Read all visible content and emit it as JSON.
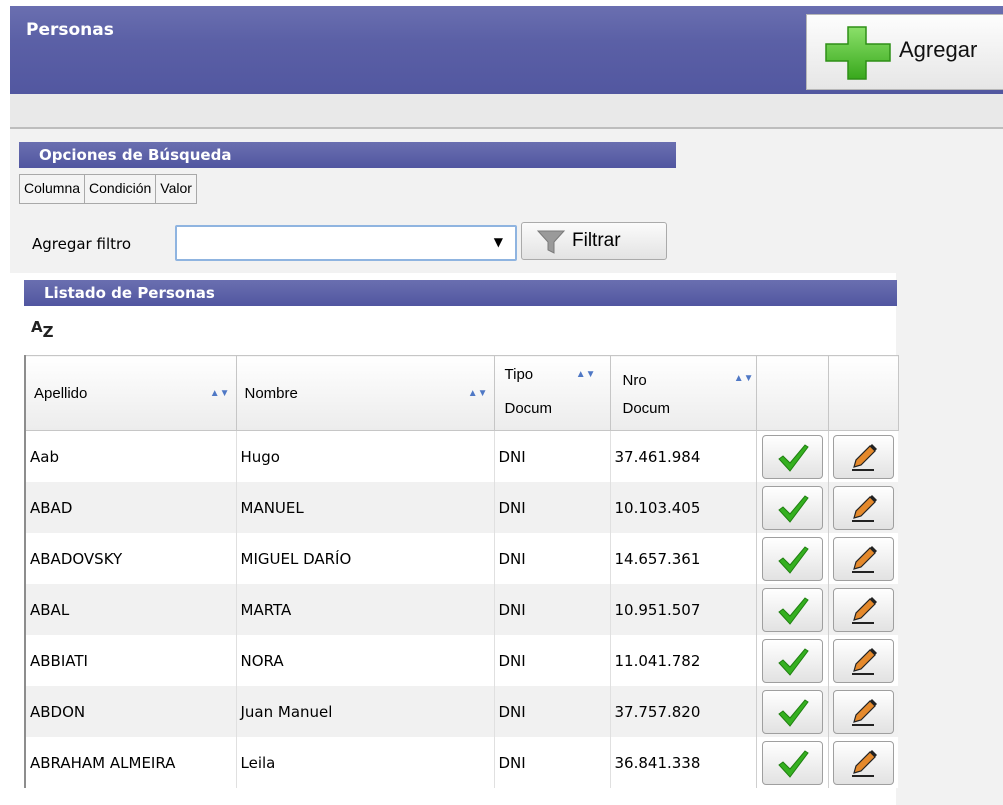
{
  "header": {
    "title": "Personas",
    "add_label": "Agregar"
  },
  "search": {
    "section_title": "Opciones de Búsqueda",
    "tabs": [
      "Columna",
      "Condición",
      "Valor"
    ],
    "filter_label": "Agregar filtro",
    "select_value": "",
    "filter_button": "Filtrar"
  },
  "list": {
    "section_title": "Listado de Personas",
    "sort_label_a": "A",
    "sort_label_z": "Z",
    "columns": [
      {
        "line1": "Apellido",
        "line2": ""
      },
      {
        "line1": "Nombre",
        "line2": ""
      },
      {
        "line1": "Tipo",
        "line2": "Docum"
      },
      {
        "line1": "Nro",
        "line2": "Docum"
      }
    ],
    "rows": [
      {
        "apellido": "Aab",
        "nombre": "Hugo",
        "tipo": "DNI",
        "nro": "37.461.984"
      },
      {
        "apellido": "ABAD",
        "nombre": "MANUEL",
        "tipo": "DNI",
        "nro": "10.103.405"
      },
      {
        "apellido": "ABADOVSKY",
        "nombre": "MIGUEL DARÍO",
        "tipo": "DNI",
        "nro": "14.657.361"
      },
      {
        "apellido": "ABAL",
        "nombre": "MARTA",
        "tipo": "DNI",
        "nro": "10.951.507"
      },
      {
        "apellido": "ABBIATI",
        "nombre": "NORA",
        "tipo": "DNI",
        "nro": "11.041.782"
      },
      {
        "apellido": "ABDON",
        "nombre": "Juan Manuel",
        "tipo": "DNI",
        "nro": "37.757.820"
      },
      {
        "apellido": "ABRAHAM ALMEIRA",
        "nombre": "Leila",
        "tipo": "DNI",
        "nro": "36.841.338"
      }
    ]
  },
  "icons": {
    "add": "plus-icon",
    "filter": "funnel-icon",
    "sort": "sort-az-icon",
    "column_sort": "sort-arrows-icon",
    "select": "check-icon",
    "edit": "pencil-icon"
  },
  "colors": {
    "header": "#5b60a6",
    "plus": "#4fbf2a",
    "check": "#2fa81c"
  }
}
